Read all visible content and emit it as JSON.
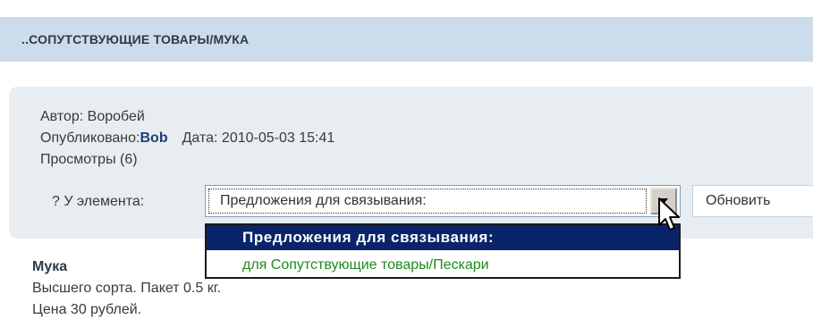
{
  "header": {
    "title": "..СОПУТСТВУЮЩИЕ ТОВАРЫ/МУКА"
  },
  "info": {
    "author": "Автор: Воробей",
    "published_label": "Опубликовано:",
    "published_name": "Bob",
    "date": "Дата: 2010-05-03 15:41",
    "views": "Просмотры (6)"
  },
  "element_select": {
    "label": "? У элемента:",
    "value": "Предложения для связывания:",
    "arrow_icon": "chevron-down-icon",
    "options": [
      "Предложения для связывания:",
      "для Сопутствующие товары/Пескари"
    ]
  },
  "update_button": {
    "label": "Обновить"
  },
  "product": {
    "title": "Мука",
    "description": "Высшего сорта. Пакет 0.5 кг.",
    "price": "Цена 30 рублей."
  },
  "colors": {
    "header_bg": "#cddcea",
    "panel_bg": "#e8edf2",
    "selected_option_bg": "#0a246a",
    "option_text": "#1d8a1d",
    "name_color": "#1f3f7a"
  }
}
